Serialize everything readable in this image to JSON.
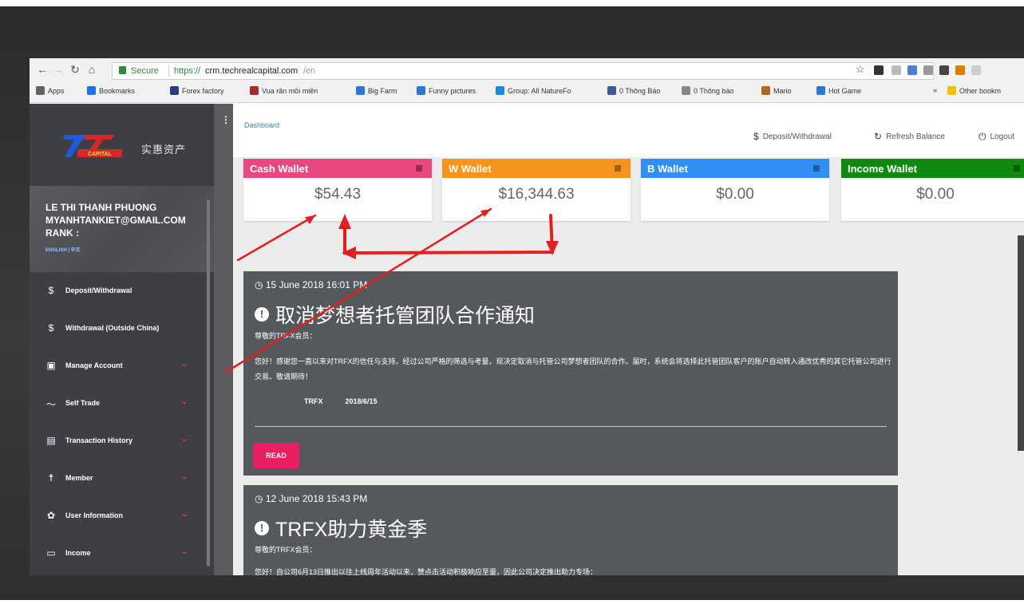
{
  "browser": {
    "secure_label": "Secure",
    "url_protocol": "https://",
    "url_host": "crm.techrealcapital.com",
    "url_path": "/en",
    "bookmarks": [
      {
        "label": "Apps",
        "color": "#5f6368"
      },
      {
        "label": "Bookmarks",
        "color": "#1a73e8"
      },
      {
        "label": "Forex factory",
        "color": "#2a3f7a"
      },
      {
        "label": "Vua rân mồi miên",
        "color": "#a52a2a"
      },
      {
        "label": "Big Farm",
        "color": "#2b76d6"
      },
      {
        "label": "Funny pictures",
        "color": "#2b76d6"
      },
      {
        "label": "Group: All NatureFo",
        "color": "#1e88e5"
      },
      {
        "label": "0 Thông Báo",
        "color": "#3b5998"
      },
      {
        "label": "0 Thông báo",
        "color": "#888888"
      },
      {
        "label": "Mario",
        "color": "#b5651d"
      },
      {
        "label": "Hot Game",
        "color": "#2b76d6"
      }
    ],
    "more_label": "»",
    "other_bookmarks": "Other bookm"
  },
  "sidebar": {
    "brand_cn": "实惠资产",
    "logo_text": "CAPITAL",
    "profile": {
      "name": "LE THI THANH PHUONG",
      "email": "MYANHTANKIET@GMAIL.COM",
      "rank": "RANK :",
      "language": "ENGLISH | 中文"
    },
    "menu": [
      {
        "icon": "dollar-icon",
        "glyph": "$",
        "label": "Deposit/Withdrawal",
        "has_caret": false
      },
      {
        "icon": "dollar-icon",
        "glyph": "$",
        "label": "Withdrawal (Outside China)",
        "has_caret": false
      },
      {
        "icon": "id-card-icon",
        "glyph": "▣",
        "label": "Manage Account",
        "has_caret": true
      },
      {
        "icon": "trend-icon",
        "glyph": "〜",
        "label": "Self Trade",
        "has_caret": true
      },
      {
        "icon": "clipboard-icon",
        "glyph": "▤",
        "label": "Transaction History",
        "has_caret": true
      },
      {
        "icon": "person-icon",
        "glyph": "☨",
        "label": "Member",
        "has_caret": true
      },
      {
        "icon": "gear-icon",
        "glyph": "✿",
        "label": "User Information",
        "has_caret": true
      },
      {
        "icon": "monitor-icon",
        "glyph": "▭",
        "label": "Income",
        "has_caret": true
      }
    ],
    "caret": "⌄"
  },
  "topbar": {
    "breadcrumb": "Dashboard",
    "deposit_withdrawal": "Deposit/Withdrawal",
    "refresh_balance": "Refresh Balance",
    "logout": "Logout"
  },
  "wallets": [
    {
      "title": "Cash Wallet",
      "value": "$54.43",
      "color": "#e8477f"
    },
    {
      "title": "W Wallet",
      "value": "$16,344.63",
      "color": "#f7941d"
    },
    {
      "title": "B Wallet",
      "value": "$0.00",
      "color": "#2f8ff5"
    },
    {
      "title": "Income Wallet",
      "value": "$0.00",
      "color": "#0f8a0f"
    }
  ],
  "announcements": [
    {
      "date": "15 June 2018 16:01 PM",
      "title": "取消梦想者托管团队合作通知",
      "greeting": "尊敬的TRFX会员：",
      "body": "您好！感谢您一直以来对TRFX的信任与支持。经过公司严格的筛选与考量，现决定取消与托管公司梦想者团队的合作。届时，系统会将选择此托管团队客户的账户自动转入通改优秀的其它托管公司进行交易。敬请期待！",
      "signer": "TRFX",
      "sign_date": "2018/6/15",
      "read_label": "READ"
    },
    {
      "date": "12 June 2018 15:43 PM",
      "title": "TRFX助力黄金季",
      "greeting": "尊敬的TRFX会员：",
      "body": "您好！自公司6月13日推出以往上线周年活动以来，赞点击活动积极响应至量，因此公司决定推出助力专场："
    }
  ],
  "colors": {
    "sidebar_bg": "#3d3f44",
    "card_bg": "#55595e",
    "read_button": "#e91e63",
    "annotation": "#e32020"
  }
}
